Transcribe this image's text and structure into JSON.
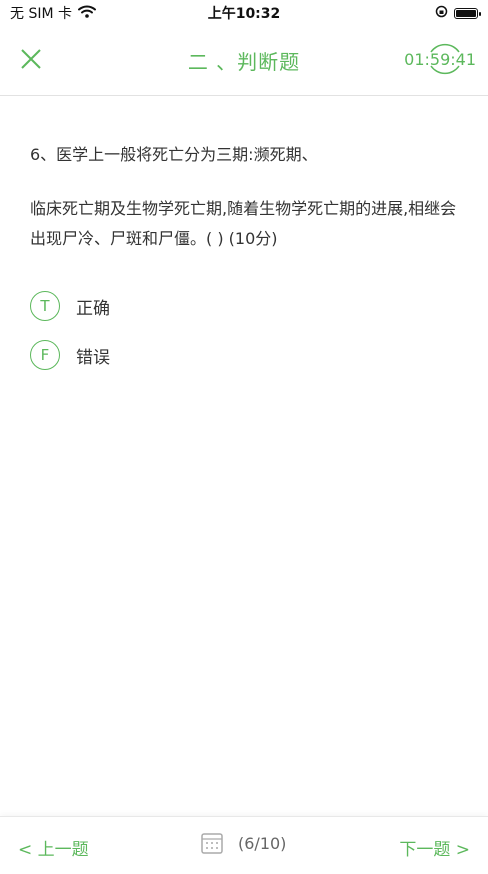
{
  "status_bar": {
    "carrier": "无 SIM 卡",
    "time": "上午10:32",
    "icons": [
      "wifi-icon",
      "orientation-lock-icon",
      "battery-icon"
    ]
  },
  "nav": {
    "close_icon": "close-icon",
    "title": "二 、判断题",
    "timer": "01:59:41"
  },
  "question": {
    "line1": "6、医学上一般将死亡分为三期:濒死期、",
    "line2": "临床死亡期及生物学死亡期,随着生物学死亡期的进展,相继会出现尸冷、尸斑和尸僵。( )  (10分)"
  },
  "options": [
    {
      "letter": "T",
      "label": "正确"
    },
    {
      "letter": "F",
      "label": "错误"
    }
  ],
  "bottom": {
    "prev_label": "< 上一题",
    "counter": "(6/10)",
    "next_label": "下一题 >"
  },
  "colors": {
    "accent": "#5cb85c",
    "text": "#333333"
  }
}
